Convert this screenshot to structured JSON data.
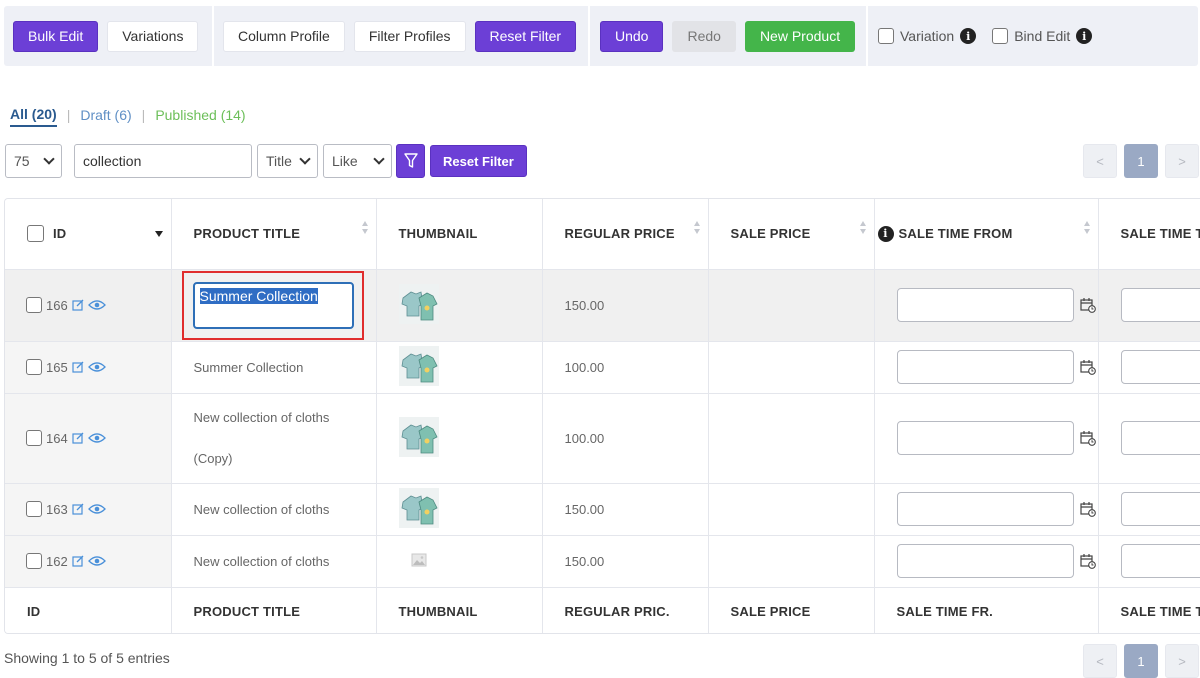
{
  "toolbar": {
    "bulk_edit": "Bulk Edit",
    "variations": "Variations",
    "column_profile": "Column Profile",
    "filter_profiles": "Filter Profiles",
    "reset_filter": "Reset Filter",
    "undo": "Undo",
    "redo": "Redo",
    "new_product": "New Product",
    "variation_label": "Variation",
    "bind_edit_label": "Bind Edit"
  },
  "status_tabs": {
    "all": "All (20)",
    "draft": "Draft (6)",
    "published": "Published (14)"
  },
  "filter": {
    "per_page": "75",
    "search_value": "collection",
    "field": "Title",
    "operator": "Like",
    "reset_label": "Reset Filter"
  },
  "pagination": {
    "prev": "<",
    "current": "1",
    "next": ">"
  },
  "table": {
    "headers": {
      "id": "ID",
      "title": "PRODUCT TITLE",
      "thumbnail": "THUMBNAIL",
      "regular_price": "REGULAR PRICE",
      "sale_price": "SALE PRICE",
      "sale_from": "SALE TIME FROM",
      "sale_to": "SALE TIME T"
    },
    "footers": {
      "id": "ID",
      "title": "PRODUCT TITLE",
      "thumbnail": "THUMBNAIL",
      "regular_price": "REGULAR PRIC.",
      "sale_price": "SALE PRICE",
      "sale_from": "SALE TIME FR.",
      "sale_to": "SALE TIME T"
    },
    "rows": [
      {
        "id": "166",
        "title": "Summer Collection",
        "price": "150.00"
      },
      {
        "id": "165",
        "title": "Summer Collection",
        "price": "100.00"
      },
      {
        "id": "164",
        "title_line1": "New collection of cloths",
        "title_line2": "(Copy)",
        "price": "100.00"
      },
      {
        "id": "163",
        "title": "New collection of cloths",
        "price": "150.00"
      },
      {
        "id": "162",
        "title": "New collection of cloths",
        "price": "150.00"
      }
    ]
  },
  "footer": {
    "showing": "Showing 1 to 5 of 5 entries"
  },
  "colors": {
    "primary": "#6c3fd6",
    "success": "#44b54a",
    "highlight_border": "#e02d2d",
    "selection": "#2f6dc4"
  }
}
